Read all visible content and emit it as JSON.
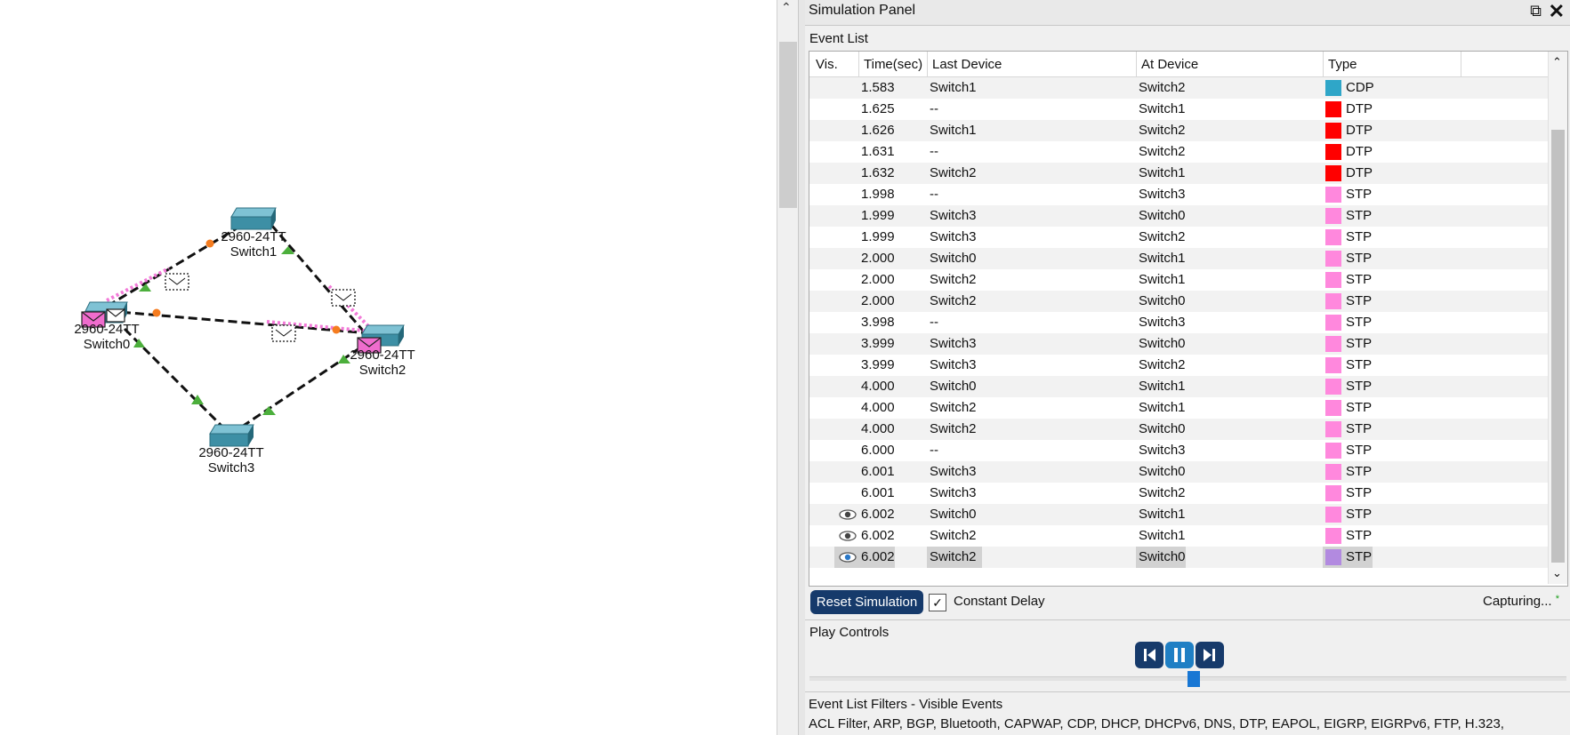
{
  "topology": {
    "devices": [
      {
        "model": "2960-24TT",
        "name": "Switch1"
      },
      {
        "model": "2960-24TT",
        "name": "Switch0"
      },
      {
        "model": "2960-24TT",
        "name": "Switch2"
      },
      {
        "model": "2960-24TT",
        "name": "Switch3"
      }
    ]
  },
  "panel": {
    "title": "Simulation Panel",
    "event_list_label": "Event List",
    "columns": [
      "Vis.",
      "Time(sec)",
      "Last Device",
      "At Device",
      "Type"
    ],
    "events": [
      {
        "vis": "",
        "time": "1.583",
        "last": "Switch1",
        "at": "Switch2",
        "type": "CDP",
        "color": "#2fa6c8"
      },
      {
        "vis": "",
        "time": "1.625",
        "last": "--",
        "at": "Switch1",
        "type": "DTP",
        "color": "#ff0000"
      },
      {
        "vis": "",
        "time": "1.626",
        "last": "Switch1",
        "at": "Switch2",
        "type": "DTP",
        "color": "#ff0000"
      },
      {
        "vis": "",
        "time": "1.631",
        "last": "--",
        "at": "Switch2",
        "type": "DTP",
        "color": "#ff0000"
      },
      {
        "vis": "",
        "time": "1.632",
        "last": "Switch2",
        "at": "Switch1",
        "type": "DTP",
        "color": "#ff0000"
      },
      {
        "vis": "",
        "time": "1.998",
        "last": "--",
        "at": "Switch3",
        "type": "STP",
        "color": "#ff88dd"
      },
      {
        "vis": "",
        "time": "1.999",
        "last": "Switch3",
        "at": "Switch0",
        "type": "STP",
        "color": "#ff88dd"
      },
      {
        "vis": "",
        "time": "1.999",
        "last": "Switch3",
        "at": "Switch2",
        "type": "STP",
        "color": "#ff88dd"
      },
      {
        "vis": "",
        "time": "2.000",
        "last": "Switch0",
        "at": "Switch1",
        "type": "STP",
        "color": "#ff88dd"
      },
      {
        "vis": "",
        "time": "2.000",
        "last": "Switch2",
        "at": "Switch1",
        "type": "STP",
        "color": "#ff88dd"
      },
      {
        "vis": "",
        "time": "2.000",
        "last": "Switch2",
        "at": "Switch0",
        "type": "STP",
        "color": "#ff88dd"
      },
      {
        "vis": "",
        "time": "3.998",
        "last": "--",
        "at": "Switch3",
        "type": "STP",
        "color": "#ff88dd"
      },
      {
        "vis": "",
        "time": "3.999",
        "last": "Switch3",
        "at": "Switch0",
        "type": "STP",
        "color": "#ff88dd"
      },
      {
        "vis": "",
        "time": "3.999",
        "last": "Switch3",
        "at": "Switch2",
        "type": "STP",
        "color": "#ff88dd"
      },
      {
        "vis": "",
        "time": "4.000",
        "last": "Switch0",
        "at": "Switch1",
        "type": "STP",
        "color": "#ff88dd"
      },
      {
        "vis": "",
        "time": "4.000",
        "last": "Switch2",
        "at": "Switch1",
        "type": "STP",
        "color": "#ff88dd"
      },
      {
        "vis": "",
        "time": "4.000",
        "last": "Switch2",
        "at": "Switch0",
        "type": "STP",
        "color": "#ff88dd"
      },
      {
        "vis": "",
        "time": "6.000",
        "last": "--",
        "at": "Switch3",
        "type": "STP",
        "color": "#ff88dd"
      },
      {
        "vis": "",
        "time": "6.001",
        "last": "Switch3",
        "at": "Switch0",
        "type": "STP",
        "color": "#ff88dd"
      },
      {
        "vis": "",
        "time": "6.001",
        "last": "Switch3",
        "at": "Switch2",
        "type": "STP",
        "color": "#ff88dd"
      },
      {
        "vis": "eye-icon",
        "time": "6.002",
        "last": "Switch0",
        "at": "Switch1",
        "type": "STP",
        "color": "#ff88dd"
      },
      {
        "vis": "eye-icon",
        "time": "6.002",
        "last": "Switch2",
        "at": "Switch1",
        "type": "STP",
        "color": "#ff88dd"
      },
      {
        "vis": "eye-icon-active",
        "time": "6.002",
        "last": "Switch2",
        "at": "Switch0",
        "type": "STP",
        "color": "#b28ae0",
        "selected": true
      }
    ],
    "reset_label": "Reset Simulation",
    "constant_delay_label": "Constant Delay",
    "constant_delay_checked": true,
    "capturing_label": "Capturing...",
    "capturing_star": "*",
    "play_controls_label": "Play Controls",
    "play_buttons": [
      "back-icon",
      "pause-icon",
      "forward-icon"
    ],
    "filters_label": "Event List Filters - Visible Events",
    "filters_text": "ACL Filter, ARP, BGP, Bluetooth, CAPWAP, CDP, DHCP, DHCPv6, DNS, DTP, EAPOL, EIGRP, EIGRPv6, FTP, H.323,"
  },
  "colors": {
    "accent": "#163a6b",
    "slider": "#1877d4"
  }
}
